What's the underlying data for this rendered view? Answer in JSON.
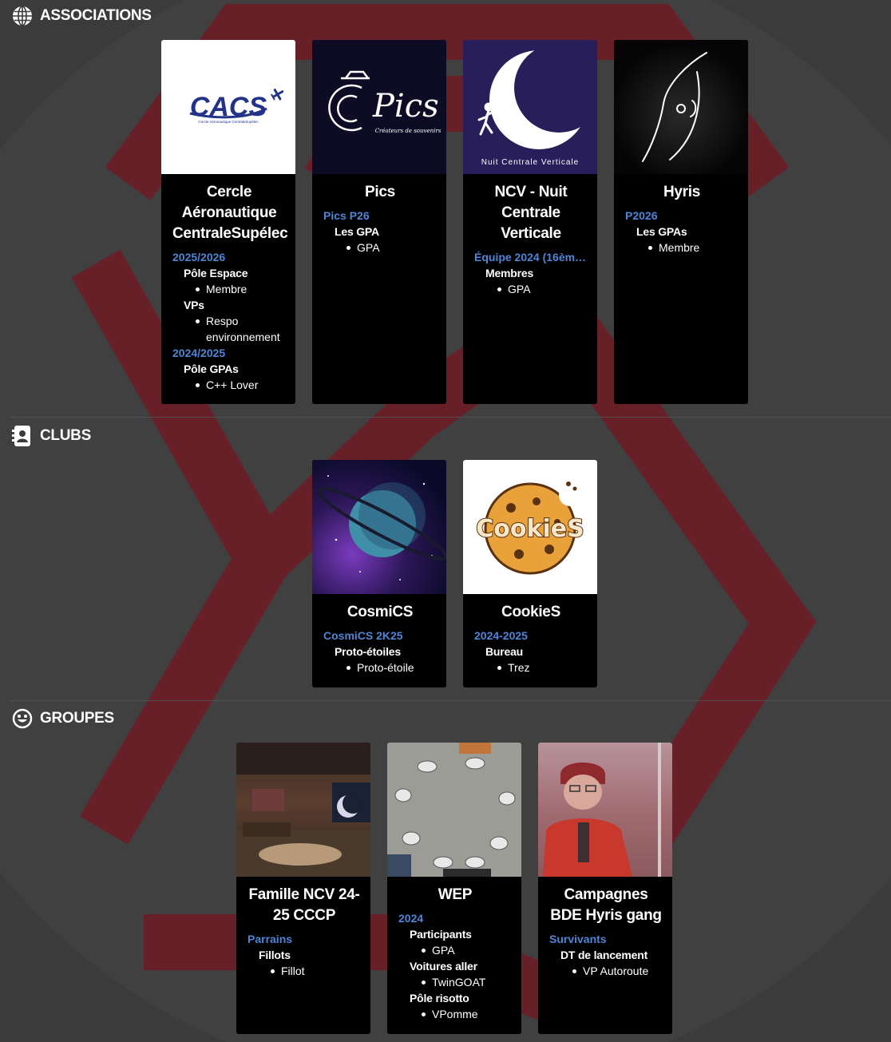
{
  "colors": {
    "background": "#3b3b3b",
    "card": "#000000",
    "term": "#4f85d6",
    "brand_red": "#6e1b24"
  },
  "sections": {
    "associations": {
      "title": "ASSOCIATIONS",
      "icon": "globe-icon",
      "cards": [
        {
          "title": "Cercle Aéronautique CentraleSupélec",
          "logo_text": "CACS",
          "logo_subtext": "Cercle Aéronautique CentraleSupélec",
          "terms": [
            {
              "label": "2025/2026",
              "groups": [
                {
                  "name": "Pôle Espace",
                  "roles": [
                    "Membre"
                  ]
                },
                {
                  "name": "VPs",
                  "roles": [
                    "Respo environnement"
                  ]
                }
              ]
            },
            {
              "label": "2024/2025",
              "groups": [
                {
                  "name": "Pôle GPAs",
                  "roles": [
                    "C++ Lover"
                  ]
                }
              ]
            }
          ]
        },
        {
          "title": "Pics",
          "logo_text": "Pics",
          "logo_subtext": "Créateurs de souvenirs",
          "terms": [
            {
              "label": "Pics P26",
              "groups": [
                {
                  "name": "Les GPA",
                  "roles": [
                    "GPA"
                  ]
                }
              ]
            }
          ]
        },
        {
          "title": "NCV - Nuit Centrale Verticale",
          "logo_text": "Nuit Centrale Verticale",
          "terms": [
            {
              "label": "Équipe 2024 (16èm…",
              "groups": [
                {
                  "name": "Membres",
                  "roles": [
                    "GPA"
                  ]
                }
              ]
            }
          ]
        },
        {
          "title": "Hyris",
          "terms": [
            {
              "label": "P2026",
              "groups": [
                {
                  "name": "Les GPAs",
                  "roles": [
                    "Membre"
                  ]
                }
              ]
            }
          ]
        }
      ]
    },
    "clubs": {
      "title": "CLUBS",
      "icon": "contact-book-icon",
      "cards": [
        {
          "title": "CosmiCS",
          "terms": [
            {
              "label": "CosmiCS 2K25",
              "groups": [
                {
                  "name": "Proto-étoiles",
                  "roles": [
                    "Proto-étoile"
                  ]
                }
              ]
            }
          ]
        },
        {
          "title": "CookieS",
          "logo_text": "CookieS",
          "terms": [
            {
              "label": "2024-2025",
              "groups": [
                {
                  "name": "Bureau",
                  "roles": [
                    "Trez"
                  ]
                }
              ]
            }
          ]
        }
      ]
    },
    "groupes": {
      "title": "GROUPES",
      "icon": "smiley-icon",
      "cards": [
        {
          "title": "Famille NCV 24-25 CCCP",
          "terms": [
            {
              "label": "Parrains",
              "groups": [
                {
                  "name": "Fillots",
                  "roles": [
                    "Fillot"
                  ]
                }
              ]
            }
          ]
        },
        {
          "title": "WEP",
          "terms": [
            {
              "label": "2024",
              "groups": [
                {
                  "name": "Participants",
                  "roles": [
                    "GPA"
                  ]
                },
                {
                  "name": "Voitures aller",
                  "roles": [
                    "TwinGOAT"
                  ]
                },
                {
                  "name": "Pôle risotto",
                  "roles": [
                    "VPomme"
                  ]
                }
              ]
            }
          ]
        },
        {
          "title": "Campagnes BDE Hyris gang",
          "terms": [
            {
              "label": "Survivants",
              "groups": [
                {
                  "name": "DT de lancement",
                  "roles": [
                    "VP Autoroute"
                  ]
                }
              ]
            }
          ]
        }
      ]
    }
  }
}
